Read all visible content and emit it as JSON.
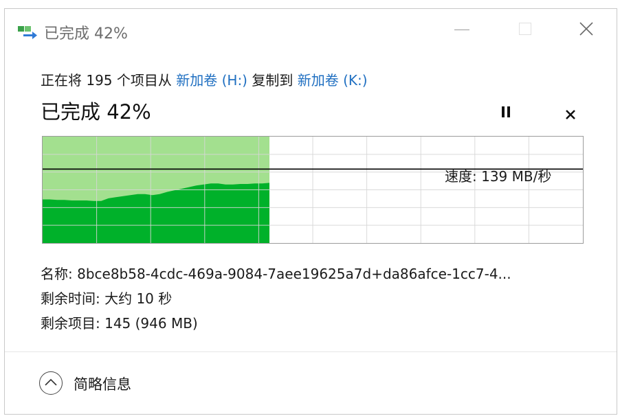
{
  "window": {
    "title": "已完成 42%",
    "icon": "copy-files-icon"
  },
  "copy": {
    "prefix": "正在将 195 个项目从 ",
    "source": "新加卷 (H:)",
    "middle": " 复制到 ",
    "destination": "新加卷 (K:)"
  },
  "status": {
    "text": "已完成 42%",
    "progress_percent": 42
  },
  "speed": {
    "label": "速度: 139 MB/秒",
    "value_mb_per_s": 139
  },
  "details": {
    "name": "名称: 8bce8b58-4cdc-469a-9084-7aee19625a7d+da86afce-1cc7-4...",
    "time_remaining": "剩余时间: 大约 10 秒",
    "items_remaining": "剩余项目: 145 (946 MB)"
  },
  "footer": {
    "toggle_label": "简略信息",
    "toggle_icon": "chevron-up-icon"
  },
  "colors": {
    "speed_fill": "#00b12a",
    "progress_fill": "#a3e08f",
    "link": "#1f6fc1",
    "grid": "#d6d6d6"
  },
  "speed_history": [
    82,
    82,
    81,
    81,
    80,
    80,
    80,
    79,
    79,
    84,
    86,
    88,
    90,
    92,
    92,
    90,
    92,
    96,
    99,
    102,
    105,
    108,
    110,
    112,
    112,
    110,
    110,
    111,
    111,
    112,
    112,
    113
  ]
}
